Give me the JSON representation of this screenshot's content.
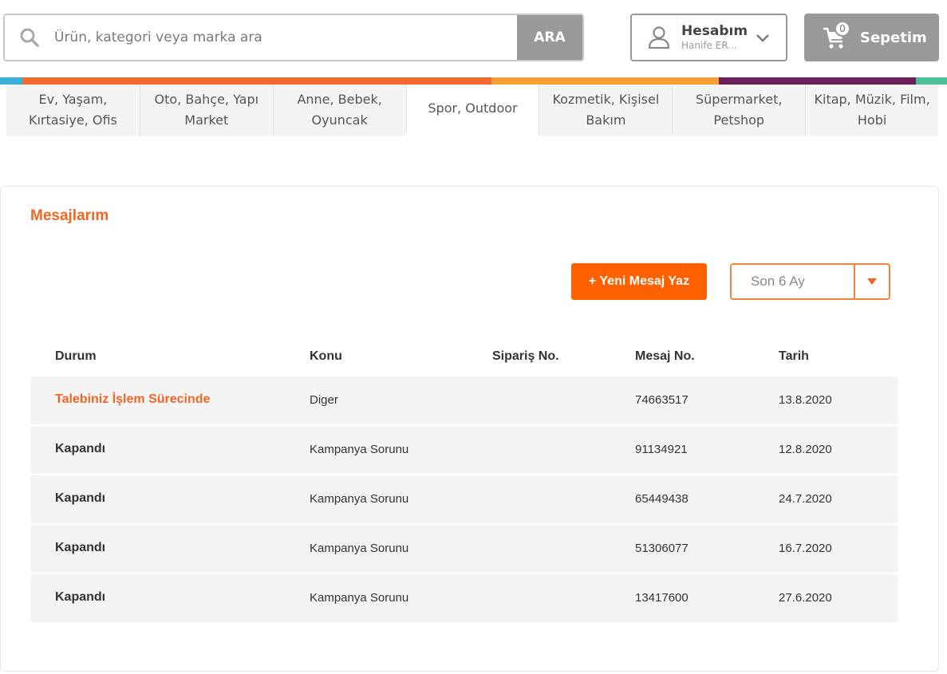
{
  "header": {
    "search": {
      "placeholder": "Ürün, kategori veya marka ara",
      "value": "",
      "button_label": "ARA"
    },
    "account": {
      "title": "Hesabım",
      "user": "Hanife ER..."
    },
    "cart": {
      "label": "Sepetim",
      "count": "0"
    }
  },
  "color_strip": [
    "#3bb1d9",
    "#f26a2e",
    "#f7a133",
    "#6d1f5c",
    "#4bbf9c"
  ],
  "categories": [
    {
      "label": "Ev, Yaşam, Kırtasiye, Ofis"
    },
    {
      "label": "Oto, Bahçe, Yapı Market"
    },
    {
      "label": "Anne, Bebek, Oyuncak"
    },
    {
      "label": "Spor, Outdoor"
    },
    {
      "label": "Kozmetik, Kişisel Bakım"
    },
    {
      "label": "Süpermarket, Petshop"
    },
    {
      "label": "Kitap, Müzik, Film, Hobi"
    }
  ],
  "messages": {
    "title": "Mesajlarım",
    "new_button": "+ Yeni Mesaj Yaz",
    "period": {
      "selected": "Son 6 Ay"
    },
    "columns": {
      "status": "Durum",
      "subject": "Konu",
      "order": "Sipariş No.",
      "message_no": "Mesaj No.",
      "date": "Tarih"
    },
    "rows": [
      {
        "status": "Talebiniz İşlem Sürecinde",
        "subject": "Diger",
        "order": "",
        "message_no": "74663517",
        "date": "13.8.2020"
      },
      {
        "status": "Kapandı",
        "subject": "Kampanya Sorunu",
        "order": "",
        "message_no": "91134921",
        "date": "12.8.2020"
      },
      {
        "status": "Kapandı",
        "subject": "Kampanya Sorunu",
        "order": "",
        "message_no": "65449438",
        "date": "24.7.2020"
      },
      {
        "status": "Kapandı",
        "subject": "Kampanya Sorunu",
        "order": "",
        "message_no": "51306077",
        "date": "16.7.2020"
      },
      {
        "status": "Kapandı",
        "subject": "Kampanya Sorunu",
        "order": "",
        "message_no": "13417600",
        "date": "27.6.2020"
      }
    ],
    "colors": {
      "accent": "#ff6000",
      "open_status": "#f26522"
    }
  }
}
